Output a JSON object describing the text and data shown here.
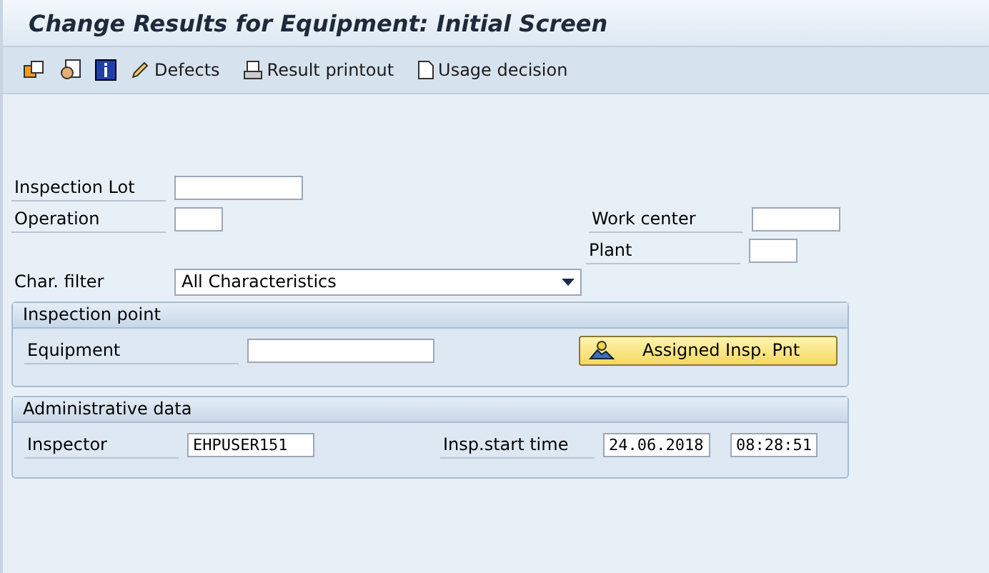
{
  "window": {
    "title": "Change Results for Equipment: Initial Screen"
  },
  "toolbar": [
    {
      "kind": "edit",
      "label": "Defects"
    },
    {
      "kind": "print",
      "label": "Result printout"
    },
    {
      "kind": "document",
      "label": "Usage decision"
    }
  ],
  "fields": {
    "inspection_lot": {
      "label": "Inspection Lot"
    },
    "operation": {
      "label": "Operation"
    },
    "work_center": {
      "label": "Work center"
    },
    "plant": {
      "label": "Plant"
    },
    "char_filter": {
      "label": "Char. filter",
      "value": "All Characteristics"
    }
  },
  "inspection_point": {
    "title": "Inspection point",
    "equipment": {
      "label": "Equipment"
    },
    "button": {
      "label": "Assigned Insp. Pnt"
    }
  },
  "administrative_data": {
    "title": "Administrative data",
    "inspector": {
      "label": "Inspector",
      "value": "EHPUSER151"
    },
    "start_time": {
      "label": "Insp.start time",
      "date": "24.06.2018",
      "time": "08:28:51"
    }
  }
}
